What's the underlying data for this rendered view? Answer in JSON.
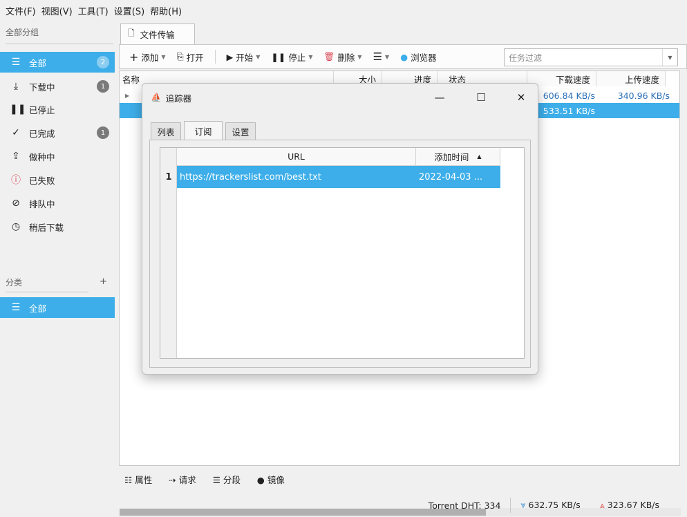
{
  "menubar": {
    "items": [
      "文件(F)",
      "视图(V)",
      "工具(T)",
      "设置(S)",
      "帮助(H)"
    ]
  },
  "sidebar": {
    "groups_title": "全部分组",
    "groups": [
      {
        "label": "全部",
        "icon": "list-icon",
        "badge": "2",
        "active": true
      },
      {
        "label": "下载中",
        "icon": "download-icon",
        "badge": "1"
      },
      {
        "label": "已停止",
        "icon": "pause-icon"
      },
      {
        "label": "已完成",
        "icon": "check-icon",
        "badge": "1"
      },
      {
        "label": "做种中",
        "icon": "upload-icon"
      },
      {
        "label": "已失败",
        "icon": "warning-icon"
      },
      {
        "label": "排队中",
        "icon": "queue-icon"
      },
      {
        "label": "稍后下载",
        "icon": "clock-icon"
      }
    ],
    "categories_title": "分类",
    "categories_add": "+",
    "categories": [
      {
        "label": "全部",
        "icon": "list-icon",
        "active": true
      }
    ]
  },
  "main": {
    "tab_label": "文件传输",
    "toolbar": {
      "add": "添加",
      "open": "打开",
      "start": "开始",
      "stop": "停止",
      "delete": "删除",
      "browser": "浏览器",
      "filter_placeholder": "任务过滤"
    },
    "table": {
      "columns": [
        "名称",
        "大小",
        "进度",
        "状态",
        "下载速度",
        "上传速度"
      ],
      "rows": [
        {
          "download_speed": "606.84 KB/s",
          "upload_speed": "340.96 KB/s"
        },
        {
          "download_speed": "533.51 KB/s",
          "upload_speed": ""
        }
      ]
    },
    "bottom_tabs": [
      "属性",
      "请求",
      "分段",
      "镜像"
    ],
    "status": {
      "dht": "Torrent DHT:  334",
      "download": "632.75 KB/s",
      "upload": "323.67 KB/s"
    }
  },
  "dialog": {
    "title": "追踪器",
    "controls": {
      "minimize": "—",
      "maximize": "☐",
      "close": "✕"
    },
    "tabs": [
      "列表",
      "订阅",
      "设置"
    ],
    "active_tab": "订阅",
    "table": {
      "columns": [
        "URL",
        "添加时间"
      ],
      "rows": [
        {
          "num": "1",
          "url": "https://trackerslist.com/best.txt",
          "added": "2022-04-03 ..."
        }
      ]
    }
  },
  "colors": {
    "accent": "#3daee9",
    "link_blue": "#2a6fb8",
    "download_arrow": "#3d8fd0",
    "upload_arrow": "#e05a5a",
    "delete_red": "#da4453"
  }
}
